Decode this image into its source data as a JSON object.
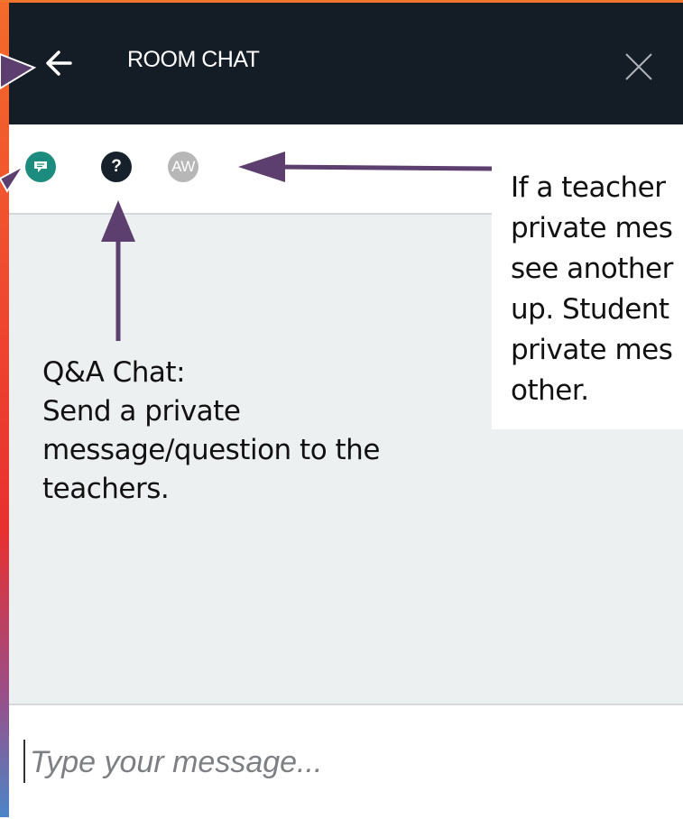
{
  "header": {
    "title": "ROOM CHAT",
    "back_icon": "arrow-left-icon",
    "close_icon": "close-icon"
  },
  "tabs": [
    {
      "name": "public-chat",
      "icon": "chat-icon"
    },
    {
      "name": "qa-chat",
      "label": "?"
    },
    {
      "name": "private-chat-aw",
      "label": "AW"
    }
  ],
  "composer": {
    "placeholder": "Type your message..."
  },
  "annotations": {
    "private_note": [
      "If a teacher",
      "private mes",
      "see another",
      "up. Student",
      "private mes",
      "other."
    ],
    "qa_note": [
      "Q&A Chat:",
      "Send a private",
      "message/question to the",
      "teachers."
    ]
  },
  "colors": {
    "header_bg": "#141c26",
    "public_tab": "#1c8c7e",
    "qa_tab": "#16212b",
    "private_tab": "#b7b7b7",
    "message_bg": "#ecf0f0",
    "annotation_arrow": "#5c3f6e"
  }
}
